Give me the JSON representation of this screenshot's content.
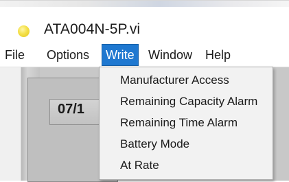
{
  "window": {
    "title": "ATA004N-5P.vi",
    "icon": "labview-vi-icon",
    "icon_color": "#f2dc3c"
  },
  "menu_bar": {
    "items": [
      {
        "label": "File"
      },
      {
        "label": "Options"
      },
      {
        "label": "Write",
        "active": true
      },
      {
        "label": "Window"
      },
      {
        "label": "Help"
      }
    ],
    "active_color": "#1f78d0"
  },
  "write_menu": {
    "items": [
      {
        "label": "Manufacturer Access"
      },
      {
        "label": "Remaining Capacity Alarm"
      },
      {
        "label": "Remaining Time Alarm"
      },
      {
        "label": "Battery Mode"
      },
      {
        "label": "At Rate"
      }
    ]
  },
  "content": {
    "date_fragment": "07/1"
  }
}
